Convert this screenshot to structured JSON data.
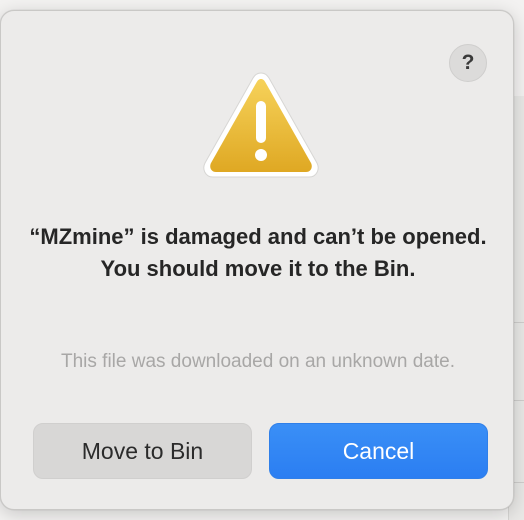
{
  "dialog": {
    "help_label": "?",
    "title": "“MZmine” is damaged and can’t be opened. You should move it to the Bin.",
    "message": "This file was downloaded on an unknown date.",
    "icon": "warning-triangle-icon"
  },
  "buttons": {
    "move_to_bin": "Move to Bin",
    "cancel": "Cancel"
  },
  "colors": {
    "primary": "#2b7ef2",
    "warning_yellow": "#e9b630",
    "dialog_bg": "#ecebea"
  }
}
